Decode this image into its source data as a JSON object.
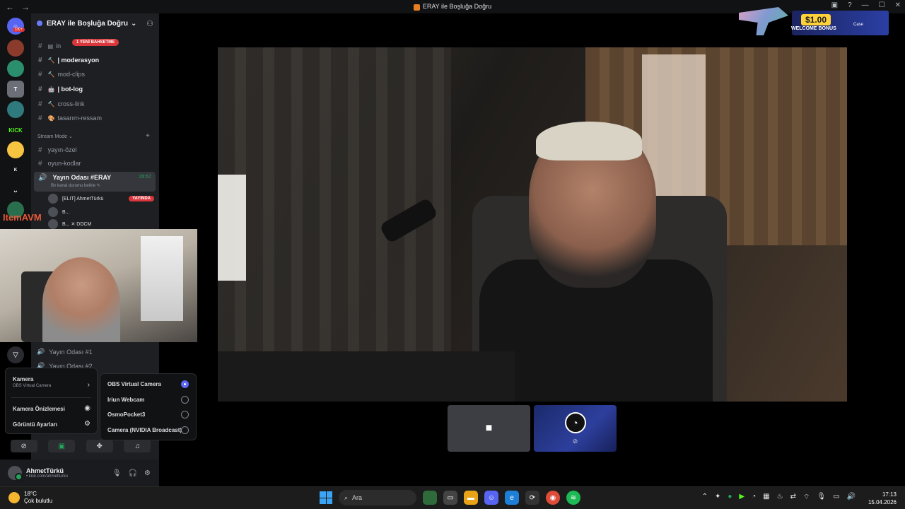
{
  "titlebar": {
    "back": "←",
    "forward": "→",
    "title": "ERAY ile Boşluğa Doğru"
  },
  "rail": {
    "badge": "1K+",
    "kick_label": "KICK",
    "item_label": "ItemAVM"
  },
  "guild": {
    "name": "ERAY ile Boşluğa Doğru",
    "chevron": "⌄"
  },
  "channels": {
    "new_mention_pill": "1 YENİ BAHSETME",
    "items": [
      {
        "label": "in",
        "emoji": "▤"
      },
      {
        "label": "| moderasyon",
        "emoji": "🔨"
      },
      {
        "label": "mod-clips",
        "emoji": "🔨"
      },
      {
        "label": "| bot-log",
        "emoji": "🤖"
      },
      {
        "label": "cross-link",
        "emoji": "🔨"
      },
      {
        "label": "tasarım-ressam",
        "emoji": "🎨"
      }
    ],
    "category": "Stream Mode",
    "stream_items": [
      {
        "label": "yayın-özel"
      },
      {
        "label": "oyun-kodlar"
      }
    ],
    "active_voice": {
      "label": "Yayın Odası #ERAY",
      "sub": "Bir kanal durumu belirle ✎",
      "timer": "25:57"
    },
    "voice_users": [
      {
        "name": "[ELIT] AhmetTürkü",
        "live": "YAYINDA"
      },
      {
        "name": "B..."
      },
      {
        "name": "B... ✕ DDCM"
      }
    ],
    "lower_voice": [
      {
        "label": "Yayın Odası #1"
      },
      {
        "label": "Yayın Odası #2"
      }
    ]
  },
  "camera_menu": {
    "camera_label": "Kamera",
    "camera_sub": "OBS Virtual Camera",
    "preview_label": "Kamera Önizlemesi",
    "settings_label": "Görüntü Ayarları"
  },
  "camera_options": [
    {
      "label": "OBS Virtual Camera",
      "selected": true
    },
    {
      "label": "Iriun Webcam",
      "selected": false
    },
    {
      "label": "OsmoPocket3",
      "selected": false
    },
    {
      "label": "Camera (NVIDIA Broadcast)",
      "selected": false
    }
  ],
  "user": {
    "name": "AhmetTürkü",
    "status": "• kick.com/ahmetturku"
  },
  "ad": {
    "amount": "$1.00",
    "text": "WELCOME BONUS",
    "brand": "Case"
  },
  "taskbar": {
    "temp": "18°C",
    "weather": "Çok bulutlu",
    "search": "Ara",
    "time": "17:13",
    "date": "15.04.2026"
  }
}
